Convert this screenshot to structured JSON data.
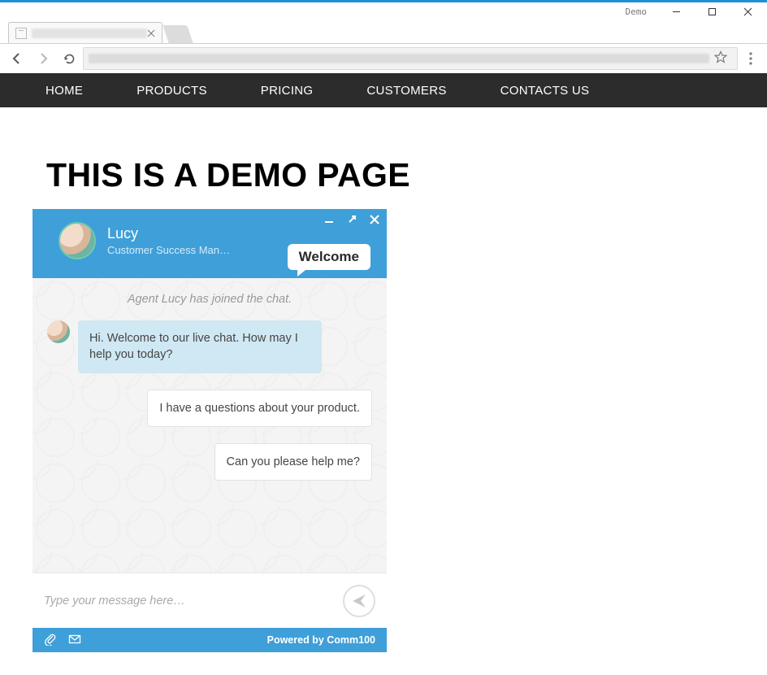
{
  "window": {
    "title": "Demo"
  },
  "nav": {
    "items": [
      "HOME",
      "PRODUCTS",
      "PRICING",
      "CUSTOMERS",
      "CONTACTS US"
    ]
  },
  "hero": "THIS IS A DEMO PAGE",
  "chat": {
    "agent": {
      "name": "Lucy",
      "title": "Customer Success Man…"
    },
    "welcome": "Welcome",
    "system": "Agent Lucy has joined the chat.",
    "messages": [
      {
        "from": "agent",
        "text": "Hi. Welcome to our live chat. How may I help you today?"
      },
      {
        "from": "user",
        "text": "I have a questions about your product."
      },
      {
        "from": "user",
        "text": "Can you please help me?"
      }
    ],
    "placeholder": "Type your message here…",
    "powered": "Powered by Comm100"
  }
}
